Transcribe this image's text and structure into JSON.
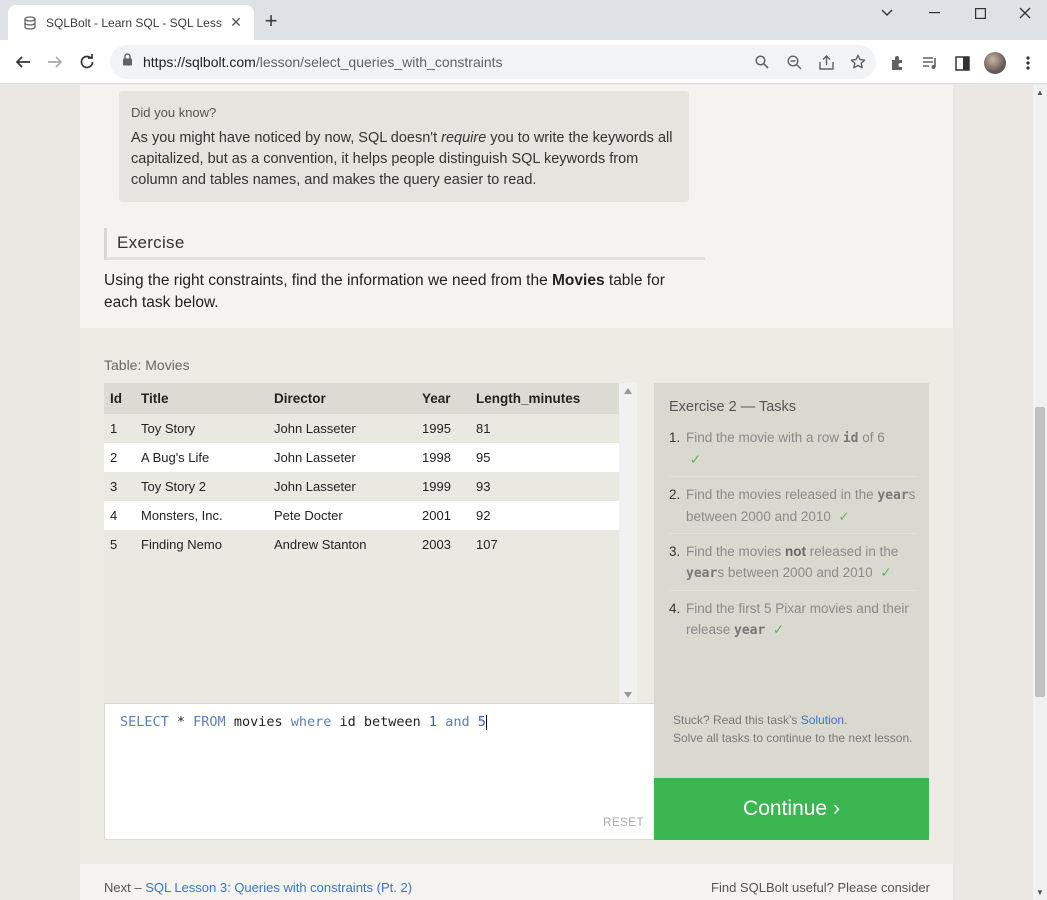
{
  "browser": {
    "tab_title": "SQLBolt - Learn SQL - SQL Lesson",
    "url_host": "https://sqlbolt.com",
    "url_path": "/lesson/select_queries_with_constraints"
  },
  "callout": {
    "title": "Did you know?",
    "body_before": "As you might have noticed by now, SQL doesn't ",
    "body_em": "require",
    "body_after": " you to write the keywords all capitalized, but as a convention, it helps people distinguish SQL keywords from column and tables names, and makes the query easier to read."
  },
  "exercise": {
    "heading": "Exercise",
    "intro_before": "Using the right constraints, find the information we need from the ",
    "intro_bold": "Movies",
    "intro_after": " table for each task below."
  },
  "table": {
    "caption": "Table: Movies",
    "columns": [
      "Id",
      "Title",
      "Director",
      "Year",
      "Length_minutes"
    ],
    "rows": [
      [
        "1",
        "Toy Story",
        "John Lasseter",
        "1995",
        "81"
      ],
      [
        "2",
        "A Bug's Life",
        "John Lasseter",
        "1998",
        "95"
      ],
      [
        "3",
        "Toy Story 2",
        "John Lasseter",
        "1999",
        "93"
      ],
      [
        "4",
        "Monsters, Inc.",
        "Pete Docter",
        "2001",
        "92"
      ],
      [
        "5",
        "Finding Nemo",
        "Andrew Stanton",
        "2003",
        "107"
      ]
    ]
  },
  "editor": {
    "tokens": {
      "select": "SELECT",
      "star": " * ",
      "from": "FROM",
      "table": " movies ",
      "where": "where",
      "col": " id between ",
      "n1": "1",
      "and": "and",
      "n2": "5"
    },
    "reset_label": "RESET"
  },
  "tasks": {
    "title": "Exercise 2 — Tasks",
    "items": [
      {
        "num": "1.",
        "a": "Find the movie with a row ",
        "code": "id",
        "b": " of 6",
        "check": "✓"
      },
      {
        "num": "2.",
        "a": "Find the movies released in the ",
        "code": "year",
        "b": "s between 2000 and 2010",
        "check": "✓"
      },
      {
        "num": "3.",
        "a": "Find the movies ",
        "bold": "not",
        "a2": " released in the ",
        "code": "year",
        "b": "s between 2000 and 2010",
        "check": "✓"
      },
      {
        "num": "4.",
        "a": "Find the first 5 Pixar movies and their release ",
        "code": "year",
        "b": "",
        "check": "✓"
      }
    ],
    "stuck_text": "Stuck? Read this task's ",
    "solution_link": "Solution",
    "stuck_after": ".",
    "solve_all": "Solve all tasks to continue to the next lesson."
  },
  "continue_label": "Continue ›",
  "footer": {
    "next_prefix": "Next – ",
    "next_link": "SQL Lesson 3: Queries with constraints (Pt. 2)",
    "right_text": "Find SQLBolt useful? Please consider"
  }
}
